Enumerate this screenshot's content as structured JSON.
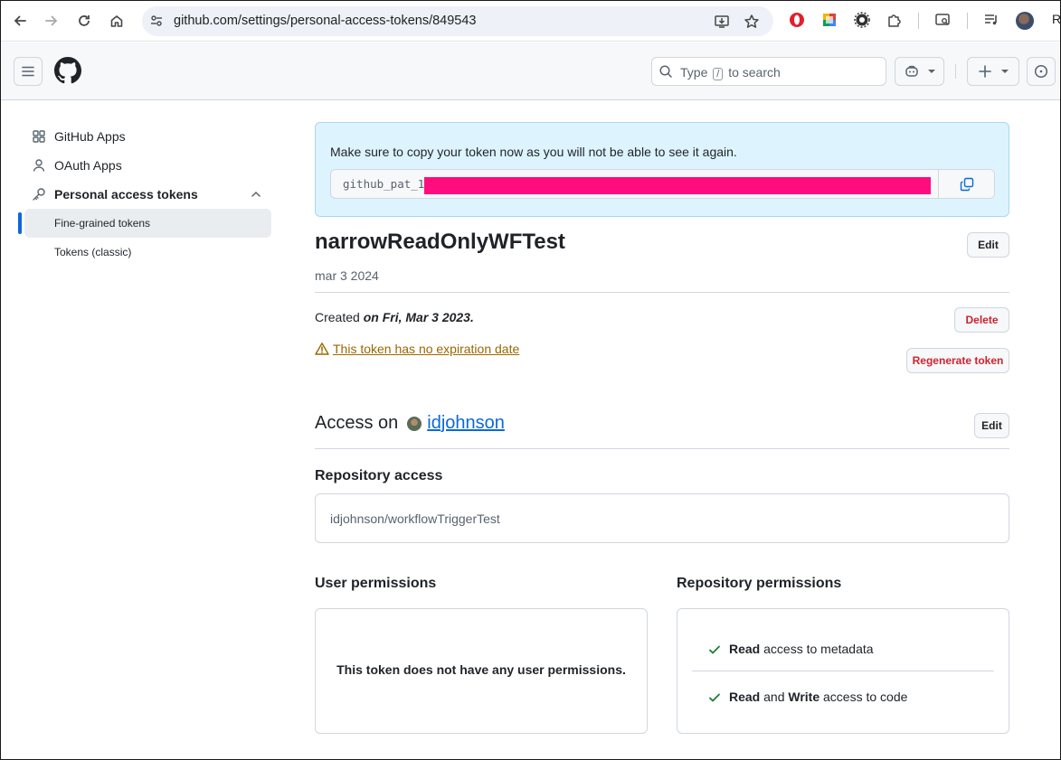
{
  "browser": {
    "url": "github.com/settings/personal-access-tokens/849543",
    "profile_initial": "R"
  },
  "header": {
    "search_prefix": "Type",
    "search_key": "/",
    "search_suffix": "to search"
  },
  "sidebar": {
    "items": [
      {
        "label": "GitHub Apps",
        "icon": "apps-icon"
      },
      {
        "label": "OAuth Apps",
        "icon": "person-icon"
      },
      {
        "label": "Personal access tokens",
        "icon": "key-icon"
      }
    ],
    "sub_items": [
      {
        "label": "Fine-grained tokens",
        "active": true
      },
      {
        "label": "Tokens (classic)",
        "active": false
      }
    ]
  },
  "flash": {
    "message": "Make sure to copy your token now as you will not be able to see it again.",
    "token_prefix": "github_pat_1"
  },
  "token": {
    "name": "narrowReadOnlyWFTest",
    "note": "mar 3 2024",
    "created_prefix": "Created",
    "created_date": "on Fri, Mar 3 2023.",
    "expiration_warning": "This token has no expiration date",
    "edit_label": "Edit",
    "delete_label": "Delete",
    "regenerate_label": "Regenerate token"
  },
  "access": {
    "prefix": "Access on",
    "owner": "idjohnson",
    "edit_label": "Edit"
  },
  "repository_access": {
    "heading": "Repository access",
    "repo": "idjohnson/workflowTriggerTest"
  },
  "user_permissions": {
    "heading": "User permissions",
    "empty_text": "This token does not have any user permissions."
  },
  "repository_permissions": {
    "heading": "Repository permissions",
    "rows": [
      {
        "level_1": "Read",
        "connector": "",
        "level_2": "",
        "suffix": "access to metadata"
      },
      {
        "level_1": "Read",
        "connector": "and",
        "level_2": "Write",
        "suffix": "access to code"
      }
    ]
  },
  "colors": {
    "accent": "#0969da",
    "danger": "#cf222e",
    "attention": "#9a6700",
    "success": "#1a7f37",
    "flash_bg": "#ddf4ff",
    "redaction": "#ff0d7f"
  }
}
